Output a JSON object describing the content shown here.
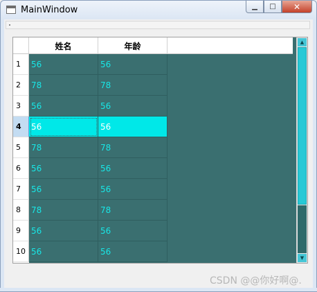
{
  "window": {
    "title": "MainWindow"
  },
  "table": {
    "columns": [
      "姓名",
      "年龄"
    ],
    "rows": [
      {
        "num": "1",
        "name": "56",
        "age": "56"
      },
      {
        "num": "2",
        "name": "78",
        "age": "78"
      },
      {
        "num": "3",
        "name": "56",
        "age": "56"
      },
      {
        "num": "4",
        "name": "56",
        "age": "56",
        "selected": true
      },
      {
        "num": "5",
        "name": "78",
        "age": "78"
      },
      {
        "num": "6",
        "name": "56",
        "age": "56"
      },
      {
        "num": "7",
        "name": "56",
        "age": "56"
      },
      {
        "num": "8",
        "name": "78",
        "age": "78"
      },
      {
        "num": "9",
        "name": "56",
        "age": "56"
      },
      {
        "num": "10",
        "name": "56",
        "age": "56"
      }
    ],
    "colors": {
      "background": "#3a6f70",
      "cell_text": "#18e6e6",
      "selected_row": "#00e8e8"
    }
  },
  "watermark": "CSDN @@你好啊@."
}
